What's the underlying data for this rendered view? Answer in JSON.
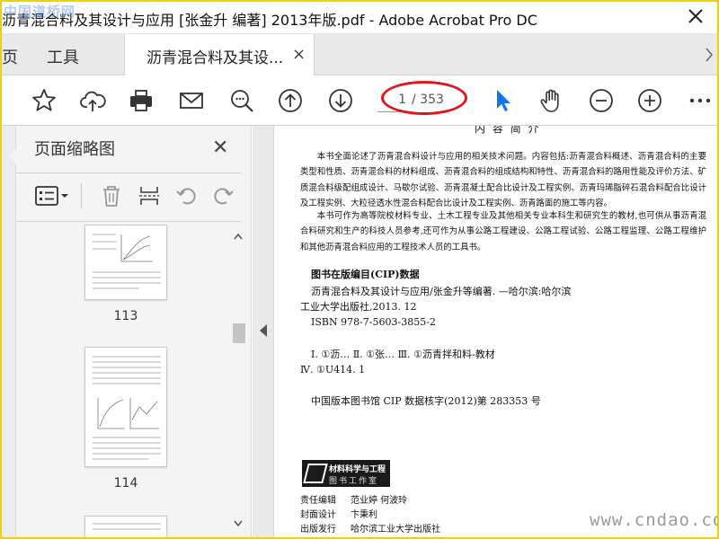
{
  "watermark_top": "中国道桥网",
  "watermark_bottom": "www.cndao.com",
  "window": {
    "title": "沥青混合料及其设计与应用 [张金升 编著] 2013年版.pdf - Adobe Acrobat Pro DC"
  },
  "tabs": {
    "home": "页",
    "tools": "工具",
    "document": "沥青混合料及其设...",
    "close": "×"
  },
  "toolbar": {
    "page_current": "1",
    "page_total": "/ 353"
  },
  "sidebar": {
    "title": "页面缩略图",
    "close": "✕",
    "thumbnails": [
      {
        "page": "113"
      },
      {
        "page": "114"
      }
    ]
  },
  "document": {
    "heading": "内 容 简 介",
    "para1": "本书全面论述了沥青混合料设计与应用的相关技术问题。内容包括:沥青混合料概述、沥青混合料的主要类型和性质、沥青混合料的材料组成、沥青混合料的组成结构和特性、沥青混合料的路用性能及评价方法、矿质混合料级配组成设计、马歇尔试验、沥青混凝土配合比设计及工程实例、沥青玛琋脂碎石混合料配合比设计及工程实例、大粒径透水性混合料配合比设计及工程实例、沥青路面的施工等内容。",
    "para2": "本书可作为高等院校材料专业、土木工程专业及其他相关专业本科生和研究生的教材,也可供从事沥青混合料研究和生产的科技人员参考,还可作为从事公路工程建设、公路工程试验、公路工程监理、公路工程维护和其他沥青混合料应用的工程技术人员的工具书。",
    "cip_title": "图书在版编目(CIP)数据",
    "cip_line1": "沥青混合料及其设计与应用/张金升等编著. —哈尔滨:哈尔滨",
    "cip_line2": "工业大学出版社,2013. 12",
    "cip_isbn": "ISBN 978-7-5603-3855-2",
    "cip_class1": "Ⅰ. ①沥…   Ⅱ. ①张…      Ⅲ. ①沥青拌和料-教材",
    "cip_class2": "Ⅳ. ①U414. 1",
    "cip_number": "中国版本图书馆 CIP 数据核字(2012)第 283353 号",
    "publisher_logo_1": "材料科学与工程",
    "publisher_logo_2": "图书工作室",
    "credits": [
      {
        "key": "责任编辑",
        "value": "范业婷   何波玲"
      },
      {
        "key": "封面设计",
        "value": "卞秉利"
      },
      {
        "key": "出版发行",
        "value": "哈尔滨工业大学出版社"
      }
    ]
  }
}
